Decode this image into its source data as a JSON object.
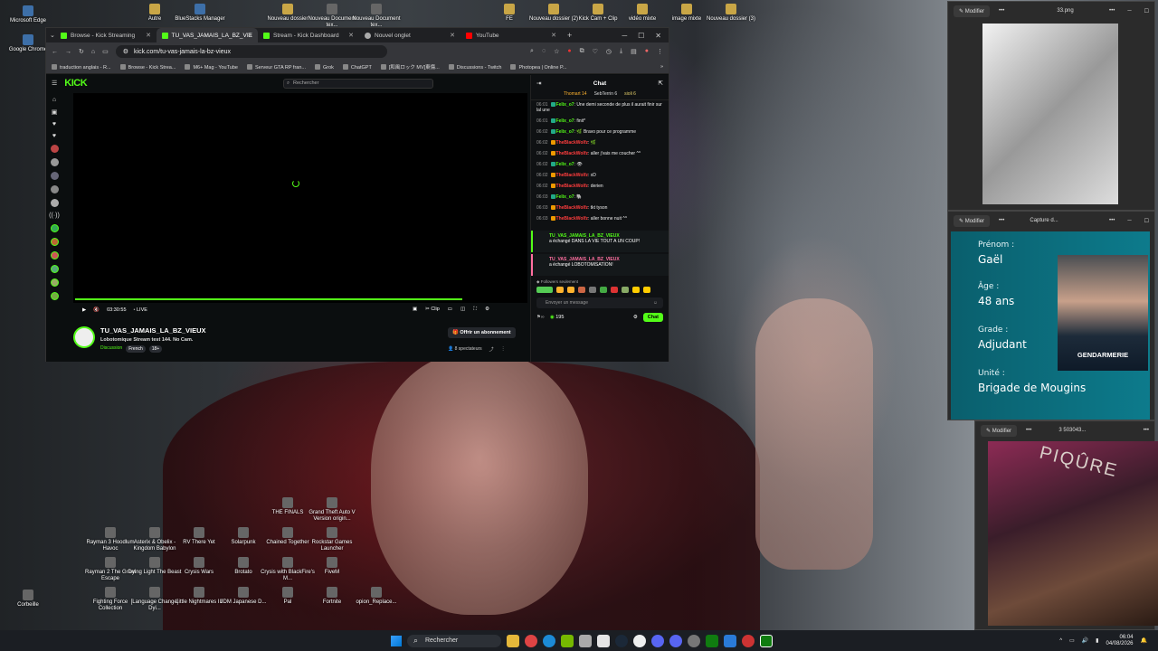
{
  "desktop": {
    "left_icons": [
      "Microsoft Edge",
      "Google Chrome",
      "Corbeille"
    ],
    "top_icons": [
      "Autre",
      "BlueStacks Manager",
      "Nouveau dossier",
      "Nouveau Document tex...",
      "Nouveau Document tex...",
      "FE",
      "Nouveau dossier (2)",
      "Kick Cam + Clip",
      "vidéo mixte",
      "image mixte",
      "Nouveau dossier (3)"
    ],
    "bottom_icons": [
      "THE FINALS",
      "Grand Theft Auto V Version origin...",
      "Rayman 3 Hoodlum Havoc",
      "Asterix & Obelix - Kingdom Babylon",
      "RV There Yet",
      "Solarpunk",
      "Chained Together",
      "Rockstar Games Launcher",
      "Rayman 2 The Great Escape",
      "Dying Light The Beast",
      "Crysis Wars",
      "Brotato",
      "Crysis with BlackFire's M...",
      "FiveM",
      "Fighting Force Collection",
      "[Language Change] Dyi...",
      "Little Nightmares III",
      "JDM Japanese D...",
      "Pal",
      "Fortnite",
      "opion_Replace..."
    ]
  },
  "browser": {
    "tabs": [
      {
        "label": "Browse - Kick Streaming",
        "icon": "kick-icon"
      },
      {
        "label": "TU_VAS_JAMAIS_LA_BZ_VIE",
        "icon": "kick-icon"
      },
      {
        "label": "Stream - Kick Dashboard",
        "icon": "kick-icon"
      },
      {
        "label": "Nouvel onglet",
        "icon": "globe-icon"
      },
      {
        "label": "YouTube",
        "icon": "youtube-icon"
      }
    ],
    "new_tab": "+",
    "url": "kick.com/tu-vas-jamais-la-bz-vieux",
    "bookmarks": [
      "traduction anglais - R...",
      "Browse - Kick Strea...",
      "M6+ Mag - YouTube",
      "Serveur GTA RP fran...",
      "Grok",
      "ChatGPT",
      "[和風ロック MV]東傷...",
      "Discussions - Twitch",
      "Photopea | Online P..."
    ],
    "bookmarks_more": "»"
  },
  "kick": {
    "logo": "KICK",
    "search_placeholder": "Rechercher",
    "kicks_count": "195",
    "player": {
      "time": "03:30:55",
      "live": "LIVE",
      "clip": "Clip"
    },
    "stream": {
      "channel": "TU_VAS_JAMAIS_LA_BZ_VIEUX",
      "title": "Lobotomique Stream test 144. No Cam.",
      "category": "Discussion",
      "tags": [
        "French",
        "18+"
      ],
      "subscribe": "Offrir un abonnement",
      "viewers": "8 spectateurs"
    },
    "chat": {
      "title": "Chat",
      "gifters": [
        "Thomart 14",
        "SebTerrin 6",
        "sioli 6"
      ],
      "messages": [
        {
          "time": "06:01",
          "user": "Felix_o7",
          "text": "Une demi seconde de plus il aurait finir sur lal une",
          "red": false
        },
        {
          "time": "06:01",
          "user": "Felix_o7",
          "text": "finit*",
          "red": false
        },
        {
          "time": "06:02",
          "user": "Felix_o7",
          "text": "Bravo pour ce programme",
          "red": false
        },
        {
          "time": "06:02",
          "user": "TheBlackWolfz",
          "text": "",
          "red": true
        },
        {
          "time": "06:02",
          "user": "TheBlackWolfz",
          "text": "aller j'vais me coucher ^^",
          "red": true
        },
        {
          "time": "06:02",
          "user": "Felix_o7",
          "text": "",
          "red": false
        },
        {
          "time": "06:02",
          "user": "TheBlackWolfz",
          "text": "xD",
          "red": true
        },
        {
          "time": "06:02",
          "user": "TheBlackWolfz",
          "text": "derien",
          "red": true
        },
        {
          "time": "06:03",
          "user": "Felix_o7",
          "text": "",
          "red": false
        },
        {
          "time": "06:03",
          "user": "TheBlackWolfz",
          "text": "tkt tyson",
          "red": true
        },
        {
          "time": "06:03",
          "user": "TheBlackWolfz",
          "text": "aller bonne nuit ^^",
          "red": true
        }
      ],
      "redeems": [
        {
          "user": "TU_VAS_JAMAIS_LA_BZ_VIEUX",
          "text": "a échangé DANS LA VIE TOUT A UN COUP!"
        },
        {
          "user": "TU_VAS_JAMAIS_LA_BZ_VIEUX",
          "text": "a échangé LOBOTOMISATION!"
        }
      ],
      "followers_only": "Followers seulement",
      "input_placeholder": "Envoyer un message",
      "points": "195",
      "send": "Chat"
    }
  },
  "right_windows": {
    "image_viewer": {
      "edit": "Modifier",
      "more": "•••",
      "filename": "33.png"
    },
    "capture": {
      "edit": "Modifier",
      "more": "•••",
      "filename": "Capture d...",
      "card": {
        "prenom_label": "Prénom :",
        "prenom": "Gaël",
        "age_label": "Âge :",
        "age": "48 ans",
        "grade_label": "Grade :",
        "grade": "Adjudant",
        "unite_label": "Unité :",
        "unite": "Brigade de Mougins",
        "badge": "GENDARMERIE"
      }
    },
    "third": {
      "edit": "Modifier",
      "more": "•••",
      "filename": "3 503043...",
      "sign": "PIQÛRE"
    }
  },
  "taskbar": {
    "search": "Rechercher",
    "time": "06:04",
    "date": "04/08/2026"
  }
}
